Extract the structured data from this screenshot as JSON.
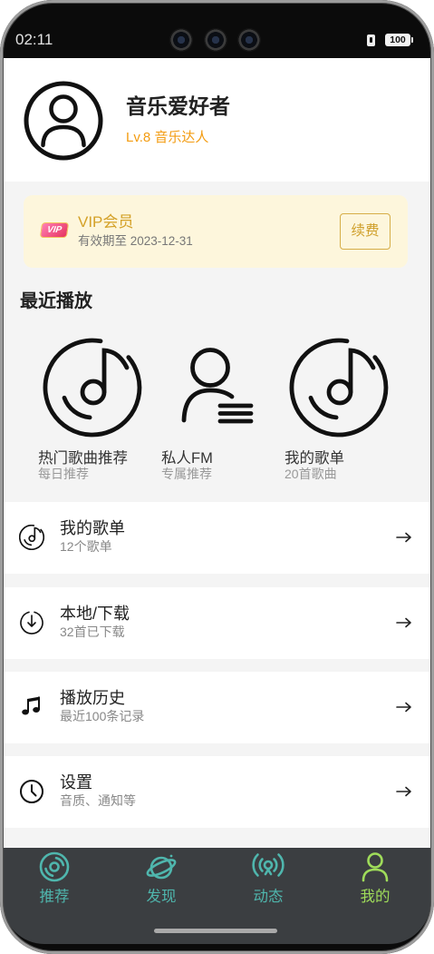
{
  "status_bar": {
    "time": "02:11",
    "battery": "100"
  },
  "profile": {
    "name": "音乐爱好者",
    "level": "Lv.8 音乐达人",
    "avatar_icon": "user-avatar-icon"
  },
  "vip": {
    "badge": "VIP",
    "title": "VIP会员",
    "expiry": "有效期至 2023-12-31",
    "renew_label": "续费"
  },
  "recent": {
    "heading": "最近播放",
    "items": [
      {
        "title": "热门歌曲推荐",
        "subtitle": "每日推荐",
        "icon": "disc-icon"
      },
      {
        "title": "私人FM",
        "subtitle": "专属推荐",
        "icon": "user-list-icon"
      },
      {
        "title": "我的歌单",
        "subtitle": "20首歌曲",
        "icon": "disc-icon"
      }
    ]
  },
  "menu": [
    {
      "title": "我的歌单",
      "subtitle": "12个歌单",
      "icon": "disc-icon"
    },
    {
      "title": "本地/下载",
      "subtitle": "32首已下载",
      "icon": "download-icon"
    },
    {
      "title": "播放历史",
      "subtitle": "最近100条记录",
      "icon": "music-note-icon"
    },
    {
      "title": "设置",
      "subtitle": "音质、通知等",
      "icon": "clock-icon"
    }
  ],
  "tabs": [
    {
      "label": "推荐",
      "icon": "disc-icon",
      "active": false
    },
    {
      "label": "发现",
      "icon": "planet-icon",
      "active": false
    },
    {
      "label": "动态",
      "icon": "broadcast-icon",
      "active": false
    },
    {
      "label": "我的",
      "icon": "user-icon",
      "active": true
    }
  ],
  "colors": {
    "level_text": "#f39c12",
    "vip_gold": "#d4a128",
    "tab_bar": "#3b3e41",
    "tab_inactive": "#4fb6ad",
    "tab_active": "#9fdc5a"
  }
}
